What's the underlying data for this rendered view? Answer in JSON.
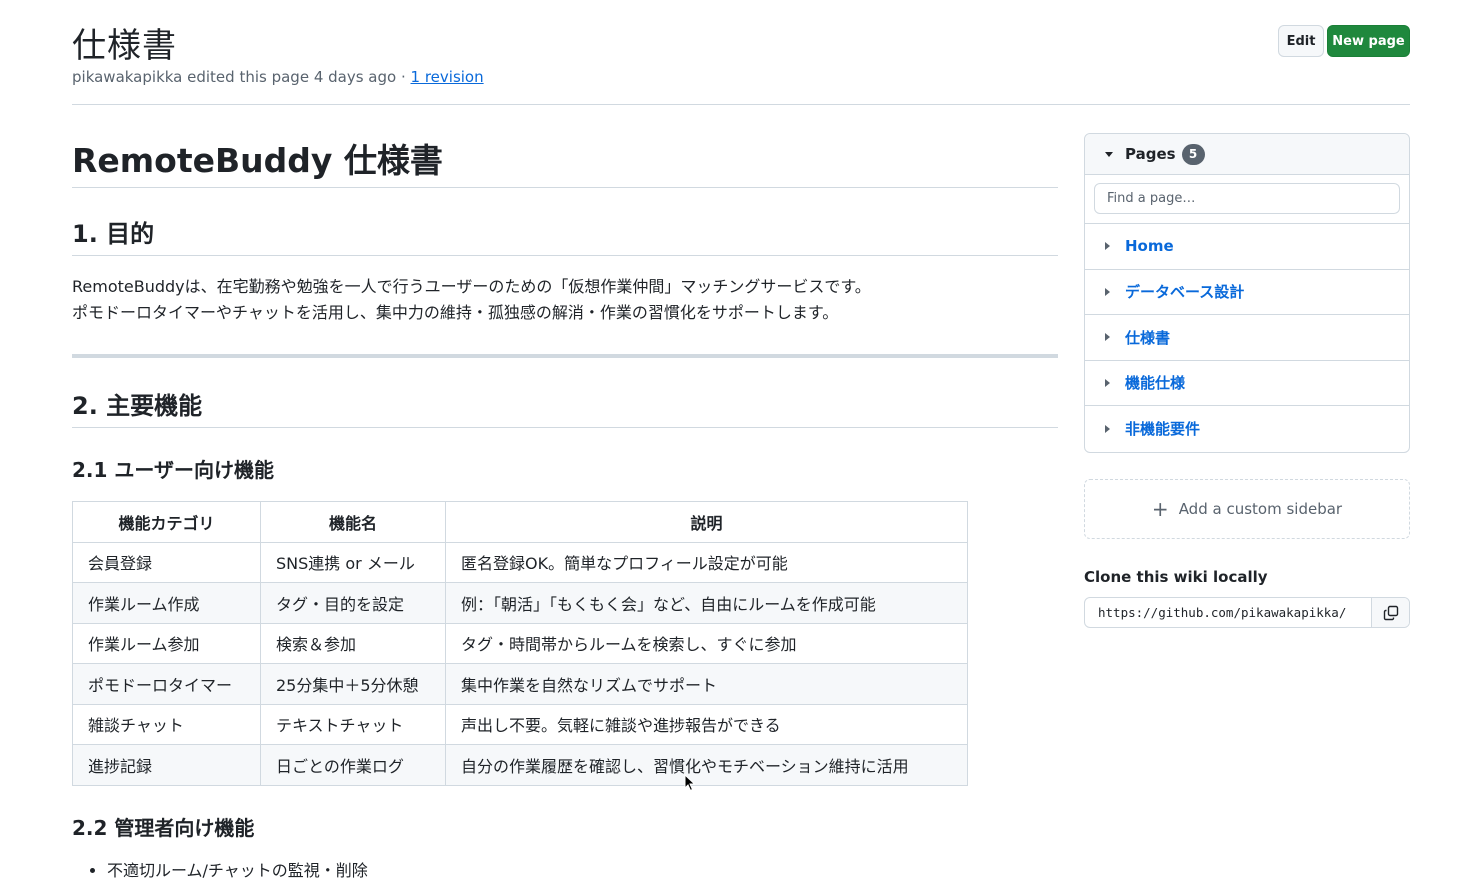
{
  "header": {
    "title": "仕様書",
    "meta": "pikawakapikka edited this page 4 days ago · ",
    "revision_link": "1 revision",
    "edit_label": "Edit",
    "new_page_label": "New page"
  },
  "content": {
    "h1": "RemoteBuddy 仕様書",
    "section1_title": "1. 目的",
    "section1_line1": "RemoteBuddyは、在宅勤務や勉強を一人で行うユーザーのための「仮想作業仲間」マッチングサービスです。",
    "section1_line2": "ポモドーロタイマーやチャットを活用し、集中力の維持・孤独感の解消・作業の習慣化をサポートします。",
    "section2_title": "2. 主要機能",
    "section21_title": "2.1 ユーザー向け機能",
    "table": {
      "headers": [
        "機能カテゴリ",
        "機能名",
        "説明"
      ],
      "rows": [
        [
          "会員登録",
          "SNS連携 or メール",
          "匿名登録OK。簡単なプロフィール設定が可能"
        ],
        [
          "作業ルーム作成",
          "タグ・目的を設定",
          "例：「朝活」「もくもく会」など、自由にルームを作成可能"
        ],
        [
          "作業ルーム参加",
          "検索＆参加",
          "タグ・時間帯からルームを検索し、すぐに参加"
        ],
        [
          "ポモドーロタイマー",
          "25分集中＋5分休憩",
          "集中作業を自然なリズムでサポート"
        ],
        [
          "雑談チャット",
          "テキストチャット",
          "声出し不要。気軽に雑談や進捗報告ができる"
        ],
        [
          "進捗記録",
          "日ごとの作業ログ",
          "自分の作業履歴を確認し、習慣化やモチベーション維持に活用"
        ]
      ]
    },
    "section22_title": "2.2 管理者向け機能",
    "section22_items": [
      "不適切ルーム/チャットの監視・削除"
    ]
  },
  "sidebar": {
    "pages_label": "Pages",
    "pages_count": "5",
    "find_placeholder": "Find a page…",
    "pages": [
      "Home",
      "データベース設計",
      "仕様書",
      "機能仕様",
      "非機能要件"
    ],
    "custom_sidebar_label": "Add a custom sidebar",
    "clone_title": "Clone this wiki locally",
    "clone_url": "https://github.com/pikawakapikka/"
  },
  "colors": {
    "link": "#0969da",
    "primary_button": "#1f883d",
    "border": "#d1d9e0",
    "muted_text": "#59636e"
  },
  "icons": [
    "triangle-down-icon",
    "triangle-right-icon",
    "plus-icon",
    "copy-icon",
    "mouse-cursor-icon"
  ]
}
